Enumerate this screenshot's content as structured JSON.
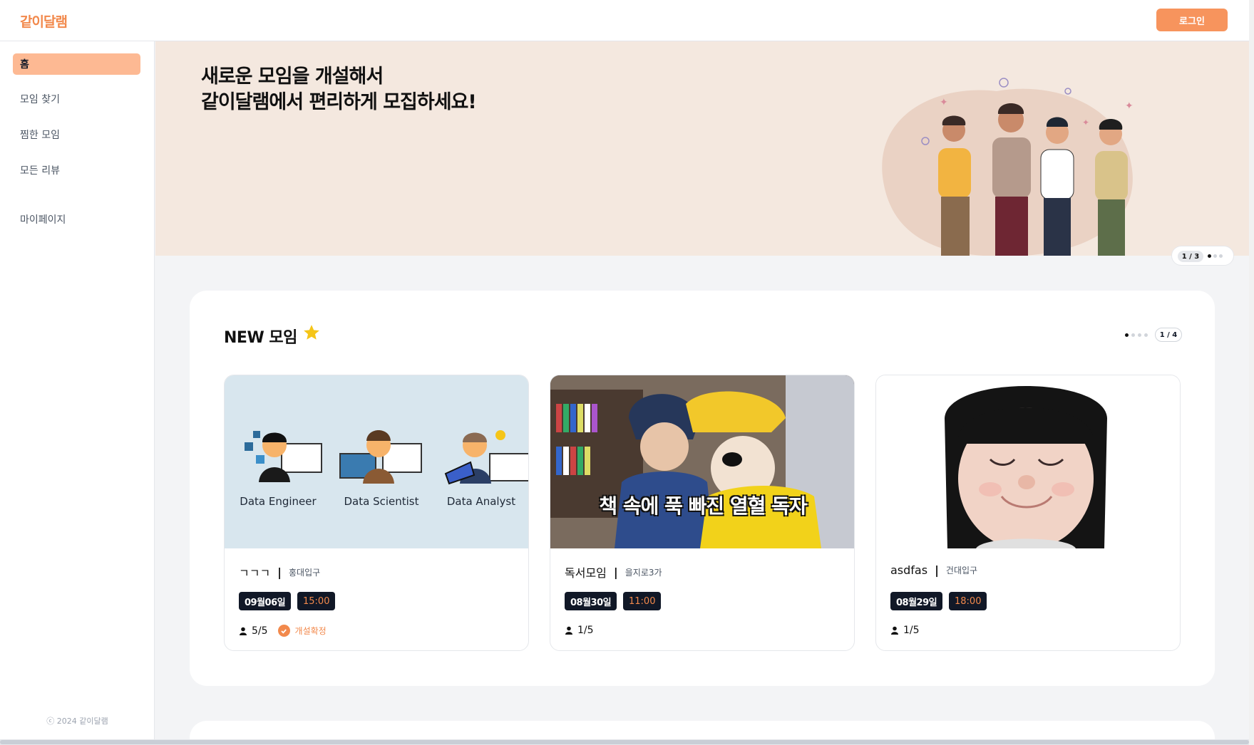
{
  "header": {
    "logo": "같이달램",
    "login_label": "로그인"
  },
  "sidebar": {
    "items": [
      {
        "label": "홈",
        "active": true
      },
      {
        "label": "모임 찾기"
      },
      {
        "label": "찜한 모임"
      },
      {
        "label": "모든 리뷰"
      },
      {
        "label": "마이페이지"
      }
    ],
    "copyright": "ⓒ 2024 같이달램"
  },
  "banner": {
    "title_line1": "새로운 모임을 개설해서",
    "title_line2": "같이달램에서 편리하게 모집하세요!",
    "pager": "1 / 3"
  },
  "new_section": {
    "title": "NEW 모임",
    "pager": "1 / 4",
    "cards": [
      {
        "name": "ㄱㄱㄱ",
        "location": "홍대입구",
        "date": "09월06일",
        "time": "15:00",
        "participants": "5/5",
        "confirmed_label": "개설확정",
        "image_labels": [
          "Data Engineer",
          "Data Scientist",
          "Data Analyst"
        ]
      },
      {
        "name": "독서모임",
        "location": "을지로3가",
        "date": "08월30일",
        "time": "11:00",
        "participants": "1/5",
        "image_caption": "책 속에 푹 빠진 열혈 독자"
      },
      {
        "name": "asdfas",
        "location": "건대입구",
        "date": "08월29일",
        "time": "18:00",
        "participants": "1/5"
      }
    ]
  },
  "colors": {
    "brand": "#f2894c",
    "active_nav": "#fdb993",
    "banner_bg": "#f4e8df",
    "chip_bg": "#111827"
  }
}
